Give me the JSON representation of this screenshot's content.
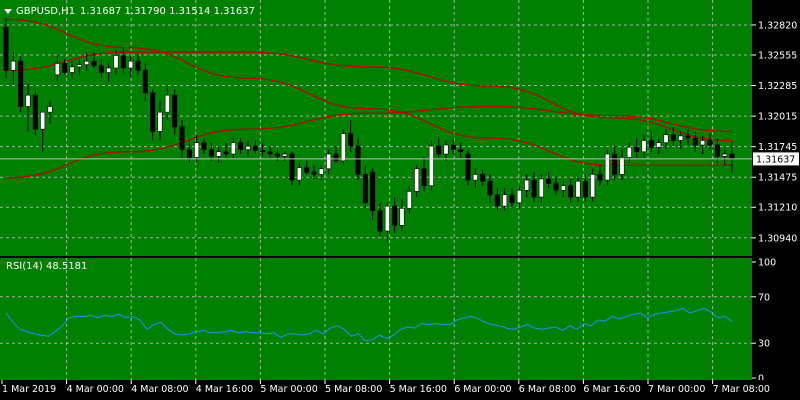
{
  "window": {
    "symbol_timeframe": "GBPUSD,H1",
    "ohlc": "1.31687 1.31790 1.31514 1.31637",
    "menu_icon": "triangle-down-icon"
  },
  "colors": {
    "background": "#008000",
    "frame": "#000000",
    "grid": "#c8c8c8",
    "axis_text": "#ffffff",
    "bull_candle": "#ffffff",
    "bear_candle": "#000000",
    "wick": "#000000",
    "ma": "#c00000",
    "rsi_line": "#1e90ff",
    "price_line": "#c0c0c0",
    "price_label_bg": "#ffffff",
    "price_label_text": "#000000"
  },
  "chart_data": [
    {
      "type": "candlestick",
      "symbol": "GBPUSD",
      "timeframe": "H1",
      "ylim": [
        1.3085,
        1.3297
      ],
      "y_ticks": [
        "1.32820",
        "1.32555",
        "1.32285",
        "1.32015",
        "1.31745",
        "1.31475",
        "1.31210",
        "1.30940"
      ],
      "x_ticks": [
        "1 Mar 2019",
        "4 Mar 00:00",
        "4 Mar 08:00",
        "4 Mar 16:00",
        "5 Mar 00:00",
        "5 Mar 08:00",
        "5 Mar 16:00",
        "6 Mar 00:00",
        "6 Mar 08:00",
        "6 Mar 16:00",
        "7 Mar 00:00",
        "7 Mar 08:00"
      ],
      "current_price": "1.31637",
      "candles": [
        [
          1.328,
          1.3288,
          1.3235,
          1.3242
        ],
        [
          1.3242,
          1.3258,
          1.323,
          1.325
        ],
        [
          1.325,
          1.3255,
          1.3205,
          1.321
        ],
        [
          1.321,
          1.323,
          1.3188,
          1.322
        ],
        [
          1.322,
          1.3225,
          1.3185,
          1.319
        ],
        [
          1.319,
          1.3205,
          1.317,
          1.3205
        ],
        [
          1.3205,
          1.3215,
          1.3195,
          1.321
        ],
        [
          1.3238,
          1.3255,
          1.3232,
          1.3248
        ],
        [
          1.3248,
          1.3252,
          1.3238,
          1.324
        ],
        [
          1.324,
          1.325,
          1.3235,
          1.3245
        ],
        [
          1.3245,
          1.3252,
          1.3238,
          1.3247
        ],
        [
          1.3247,
          1.3258,
          1.3242,
          1.325
        ],
        [
          1.325,
          1.3258,
          1.3244,
          1.3246
        ],
        [
          1.3246,
          1.3252,
          1.3236,
          1.324
        ],
        [
          1.324,
          1.3248,
          1.3232,
          1.3244
        ],
        [
          1.3244,
          1.326,
          1.3238,
          1.3255
        ],
        [
          1.3255,
          1.3262,
          1.324,
          1.3244
        ],
        [
          1.3244,
          1.3255,
          1.3236,
          1.325
        ],
        [
          1.325,
          1.3256,
          1.3238,
          1.3242
        ],
        [
          1.3242,
          1.3248,
          1.3215,
          1.3222
        ],
        [
          1.3222,
          1.3225,
          1.318,
          1.3188
        ],
        [
          1.3188,
          1.3215,
          1.318,
          1.3205
        ],
        [
          1.3205,
          1.3228,
          1.3198,
          1.322
        ],
        [
          1.322,
          1.3225,
          1.3185,
          1.3192
        ],
        [
          1.3192,
          1.3198,
          1.3165,
          1.3172
        ],
        [
          1.3172,
          1.318,
          1.316,
          1.3165
        ],
        [
          1.3165,
          1.3185,
          1.316,
          1.3178
        ],
        [
          1.3178,
          1.3182,
          1.3168,
          1.3172
        ],
        [
          1.3172,
          1.3178,
          1.3162,
          1.3166
        ],
        [
          1.3166,
          1.3175,
          1.316,
          1.317
        ],
        [
          1.317,
          1.3178,
          1.3165,
          1.3168
        ],
        [
          1.3168,
          1.3182,
          1.3164,
          1.3178
        ],
        [
          1.3178,
          1.3182,
          1.3168,
          1.3172
        ],
        [
          1.3172,
          1.318,
          1.3165,
          1.3175
        ],
        [
          1.3175,
          1.318,
          1.3168,
          1.3171
        ],
        [
          1.3171,
          1.3178,
          1.3166,
          1.317
        ],
        [
          1.317,
          1.3175,
          1.3165,
          1.3168
        ],
        [
          1.3168,
          1.3172,
          1.3162,
          1.3166
        ],
        [
          1.3166,
          1.317,
          1.3162,
          1.3168
        ],
        [
          1.3168,
          1.317,
          1.314,
          1.3145
        ],
        [
          1.3145,
          1.316,
          1.314,
          1.3156
        ],
        [
          1.3156,
          1.3162,
          1.315,
          1.3152
        ],
        [
          1.3152,
          1.3158,
          1.3146,
          1.315
        ],
        [
          1.315,
          1.3158,
          1.3145,
          1.3155
        ],
        [
          1.3155,
          1.3172,
          1.315,
          1.3168
        ],
        [
          1.3168,
          1.3175,
          1.316,
          1.3162
        ],
        [
          1.3162,
          1.319,
          1.3158,
          1.3186
        ],
        [
          1.3186,
          1.3198,
          1.317,
          1.3175
        ],
        [
          1.3175,
          1.3182,
          1.3145,
          1.315
        ],
        [
          1.315,
          1.3158,
          1.312,
          1.3125
        ],
        [
          1.3152,
          1.3156,
          1.311,
          1.3118
        ],
        [
          1.3118,
          1.3125,
          1.3095,
          1.31
        ],
        [
          1.31,
          1.3125,
          1.309,
          1.3122
        ],
        [
          1.3122,
          1.313,
          1.3098,
          1.3105
        ],
        [
          1.3105,
          1.3128,
          1.31,
          1.312
        ],
        [
          1.312,
          1.314,
          1.3115,
          1.3135
        ],
        [
          1.3135,
          1.3158,
          1.313,
          1.3155
        ],
        [
          1.3155,
          1.3165,
          1.3135,
          1.314
        ],
        [
          1.314,
          1.318,
          1.3136,
          1.3175
        ],
        [
          1.3175,
          1.3182,
          1.3165,
          1.3168
        ],
        [
          1.3168,
          1.318,
          1.3162,
          1.3176
        ],
        [
          1.3176,
          1.3182,
          1.3168,
          1.3172
        ],
        [
          1.3172,
          1.3178,
          1.3165,
          1.317
        ],
        [
          1.3168,
          1.3172,
          1.314,
          1.3145
        ],
        [
          1.3145,
          1.3155,
          1.3138,
          1.315
        ],
        [
          1.315,
          1.3154,
          1.314,
          1.3144
        ],
        [
          1.3144,
          1.315,
          1.3125,
          1.3132
        ],
        [
          1.3132,
          1.3138,
          1.3118,
          1.3122
        ],
        [
          1.3122,
          1.3138,
          1.3118,
          1.3132
        ],
        [
          1.3132,
          1.3138,
          1.312,
          1.3125
        ],
        [
          1.3125,
          1.314,
          1.312,
          1.3136
        ],
        [
          1.3136,
          1.315,
          1.313,
          1.3145
        ],
        [
          1.3145,
          1.3152,
          1.3126,
          1.313
        ],
        [
          1.313,
          1.315,
          1.3125,
          1.3146
        ],
        [
          1.3146,
          1.3152,
          1.3138,
          1.3142
        ],
        [
          1.3142,
          1.3148,
          1.3132,
          1.3136
        ],
        [
          1.3136,
          1.3145,
          1.313,
          1.314
        ],
        [
          1.314,
          1.3146,
          1.3125,
          1.313
        ],
        [
          1.313,
          1.3148,
          1.3126,
          1.3144
        ],
        [
          1.3144,
          1.315,
          1.3126,
          1.313
        ],
        [
          1.313,
          1.3155,
          1.3126,
          1.315
        ],
        [
          1.315,
          1.3158,
          1.314,
          1.3145
        ],
        [
          1.3145,
          1.3172,
          1.314,
          1.3168
        ],
        [
          1.3168,
          1.3175,
          1.3145,
          1.315
        ],
        [
          1.315,
          1.3172,
          1.3145,
          1.3165
        ],
        [
          1.3165,
          1.3178,
          1.316,
          1.3174
        ],
        [
          1.3174,
          1.3182,
          1.3165,
          1.317
        ],
        [
          1.317,
          1.3185,
          1.3165,
          1.318
        ],
        [
          1.318,
          1.3188,
          1.317,
          1.3174
        ],
        [
          1.3174,
          1.3182,
          1.3168,
          1.3178
        ],
        [
          1.3178,
          1.319,
          1.3172,
          1.3185
        ],
        [
          1.3185,
          1.3192,
          1.3175,
          1.318
        ],
        [
          1.318,
          1.3188,
          1.3172,
          1.3184
        ],
        [
          1.3184,
          1.319,
          1.3176,
          1.3182
        ],
        [
          1.3182,
          1.3188,
          1.317,
          1.3176
        ],
        [
          1.3176,
          1.3184,
          1.3168,
          1.318
        ],
        [
          1.318,
          1.3186,
          1.3172,
          1.3176
        ],
        [
          1.3176,
          1.3182,
          1.316,
          1.3166
        ],
        [
          1.3166,
          1.3172,
          1.3158,
          1.3168
        ],
        [
          1.3168,
          1.3179,
          1.3151,
          1.3164
        ]
      ],
      "moving_averages": [
        {
          "points": [
            [
              0,
              1.3147
            ],
            [
              20,
              1.317
            ],
            [
              40,
              1.319
            ],
            [
              60,
              1.3204
            ],
            [
              80,
              1.321
            ],
            [
              100,
              1.3202
            ],
            [
              120,
              1.3188
            ]
          ]
        },
        {
          "points": [
            [
              0,
              1.3287
            ],
            [
              20,
              1.3262
            ],
            [
              40,
              1.3235
            ],
            [
              60,
              1.3208
            ],
            [
              80,
              1.3182
            ],
            [
              100,
              1.3158
            ],
            [
              120,
              1.3158
            ]
          ]
        },
        {
          "points": [
            [
              0,
              1.3242
            ],
            [
              20,
              1.3258
            ],
            [
              40,
              1.3258
            ],
            [
              60,
              1.3245
            ],
            [
              80,
              1.3228
            ],
            [
              100,
              1.32
            ],
            [
              120,
              1.318
            ]
          ]
        }
      ]
    },
    {
      "type": "line",
      "indicator": "RSI(14)",
      "label": "RSI(14) 48.5181",
      "ylim": [
        0,
        100
      ],
      "y_ticks": [
        "100",
        "70",
        "30",
        "0"
      ],
      "levels": [
        70,
        30
      ],
      "values": [
        56,
        48,
        42,
        40,
        38,
        37,
        36,
        40,
        45,
        52,
        53,
        53,
        54,
        52,
        54,
        53,
        55,
        52,
        53,
        50,
        42,
        46,
        48,
        42,
        38,
        37,
        38,
        40,
        41,
        39,
        39,
        40,
        41,
        39,
        40,
        39,
        39,
        38,
        39,
        35,
        38,
        38,
        37,
        38,
        41,
        38,
        43,
        45,
        42,
        36,
        38,
        32,
        33,
        37,
        34,
        37,
        42,
        44,
        43,
        47,
        46,
        47,
        46,
        46,
        50,
        52,
        53,
        51,
        48,
        46,
        45,
        43,
        42,
        44,
        46,
        43,
        42,
        43,
        44,
        41,
        45,
        42,
        47,
        45,
        50,
        49,
        53,
        51,
        53,
        55,
        56,
        52,
        55,
        56,
        57,
        58,
        60,
        56,
        58,
        60,
        57,
        52,
        53,
        48.5181
      ]
    }
  ]
}
